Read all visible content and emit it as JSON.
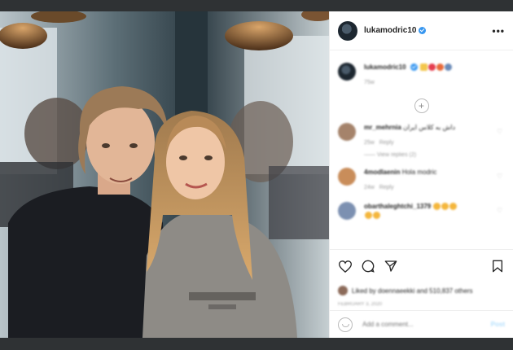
{
  "post": {
    "username": "lukamodric10",
    "more_label": "•••"
  },
  "caption": {
    "username": "lukamodric10",
    "time": "75w"
  },
  "comments": [
    {
      "username": "mr_mehrnia",
      "text": "داش به کلاس ایران",
      "time": "25w",
      "reply": "Reply",
      "view_replies": "View replies (2)"
    },
    {
      "username": "4modlaenin",
      "text": "Hola modric",
      "time": "24w",
      "reply": "Reply"
    },
    {
      "username": "obarthaleghtchi_1379"
    }
  ],
  "likes_text": "Liked by doennaeekki and 510,837 others",
  "date": "FEBRUARY 3, 2020",
  "add_comment_placeholder": "Add a comment...",
  "post_label": "Post",
  "colors": {
    "verified": "#3897f0",
    "post_button": "#b2dffc",
    "backdrop": "#2f3234"
  },
  "icons": [
    "heart-icon",
    "comment-icon",
    "share-icon",
    "bookmark-icon",
    "smile-icon",
    "plus-icon",
    "verified-icon"
  ]
}
